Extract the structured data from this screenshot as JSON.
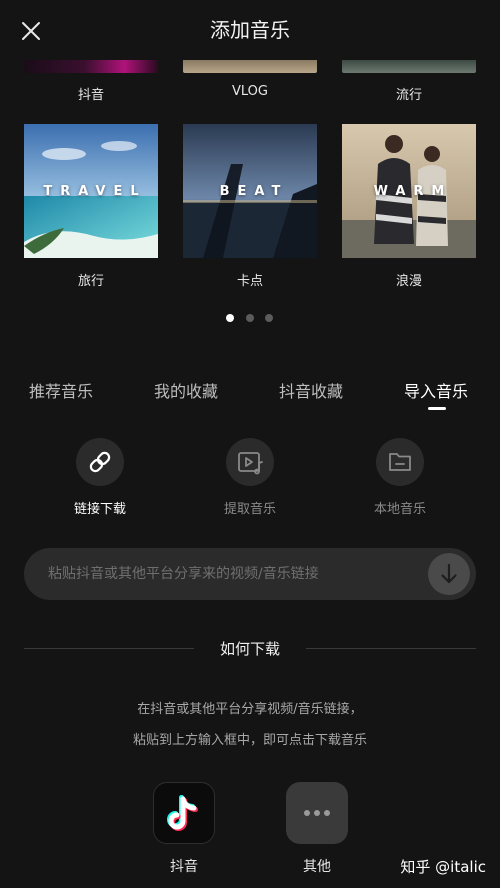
{
  "header": {
    "title": "添加音乐"
  },
  "top_row": {
    "captions": [
      "抖音",
      "VLOG",
      "流行"
    ]
  },
  "cards": [
    {
      "word": "TRAVEL",
      "caption": "旅行"
    },
    {
      "word": "BEAT",
      "caption": "卡点"
    },
    {
      "word": "WARM",
      "caption": "浪漫"
    }
  ],
  "pager": {
    "count": 3,
    "active_index": 0
  },
  "tabs": [
    {
      "label": "推荐音乐"
    },
    {
      "label": "我的收藏"
    },
    {
      "label": "抖音收藏"
    },
    {
      "label": "导入音乐"
    }
  ],
  "active_tab": "导入音乐",
  "sources": [
    {
      "label": "链接下载",
      "icon": "link-icon"
    },
    {
      "label": "提取音乐",
      "icon": "video-music-icon"
    },
    {
      "label": "本地音乐",
      "icon": "folder-icon"
    }
  ],
  "link_input": {
    "placeholder": "粘贴抖音或其他平台分享来的视频/音乐链接",
    "value": ""
  },
  "howto": {
    "title": "如何下载",
    "line1": "在抖音或其他平台分享视频/音乐链接，",
    "line2": "粘贴到上方输入框中，即可点击下载音乐"
  },
  "apps": [
    {
      "label": "抖音",
      "icon": "douyin-logo-icon"
    },
    {
      "label": "其他",
      "icon": "more-dots-icon"
    }
  ],
  "watermark": "知乎 @italic",
  "colors": {
    "background": "#141414",
    "surface": "#2b2b2b",
    "text_primary": "#ffffff",
    "text_muted": "#8a8a8a"
  }
}
